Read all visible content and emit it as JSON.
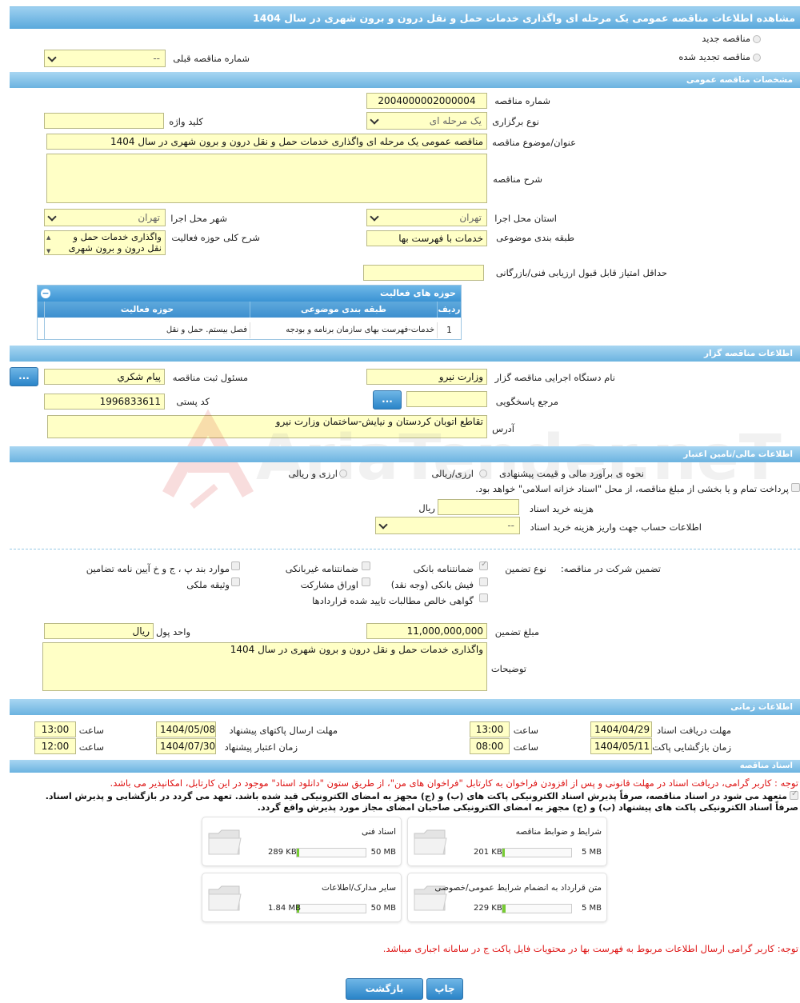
{
  "title": "مشاهده اطلاعات مناقصه عمومی یک مرحله ای واگذاری خدمات حمل و نقل درون و برون شهری در سال 1404",
  "top": {
    "radio_new": "مناقصه جدید",
    "radio_renewed": "مناقصه تجدید شده",
    "prev_tender_label": "شماره مناقصه قبلی",
    "prev_tender_value": "--"
  },
  "general": {
    "header": "مشخصات مناقصه عمومی",
    "tender_number_label": "شماره مناقصه",
    "tender_number": "2004000002000004",
    "holding_type_label": "نوع برگزاری",
    "holding_type": "یک مرحله ای",
    "keyword_label": "کلید واژه",
    "keyword": "",
    "subject_label": "عنوان/موضوع مناقصه",
    "subject": "مناقصه عمومی یک مرحله ای واگذاری خدمات حمل و نقل درون و برون شهری  در سال 1404",
    "description_label": "شرح مناقصه",
    "description": "",
    "province_label": "استان محل اجرا",
    "province": "تهران",
    "city_label": "شهر محل اجرا",
    "city": "تهران",
    "category_label": "طبقه بندی موضوعی",
    "category": "خدمات با فهرست بها",
    "activity_desc_label": "شرح کلی حوزه فعالیت",
    "activity_desc": "واگذاری خدمات حمل و نقل درون و برون شهری  در",
    "min_score_label": "حداقل امتیاز قابل قبول ارزیابی فنی/بازرگانی",
    "min_score": ""
  },
  "activities": {
    "title": "حوزه های فعالیت",
    "columns": [
      "ردیف",
      "طبقه بندی موضوعی",
      "حوزه فعالیت"
    ],
    "rows": [
      [
        "1",
        "خدمات-فهرست بهای سازمان برنامه و بودجه",
        "فصل بیستم. حمل و نقل"
      ]
    ]
  },
  "organizer": {
    "header": "اطلاعات مناقصه گزار",
    "org_name_label": "نام دستگاه اجرایی مناقصه گزار",
    "org_name": "وزارت نیرو",
    "registrar_label": "مسئول ثبت مناقصه",
    "registrar": "پیام شکري",
    "responder_label": "مرجع پاسخگویی",
    "responder": "",
    "postal_label": "کد پستی",
    "postal": "1996833611",
    "address_label": "آدرس",
    "address": "تقاطع اتوبان کردستان و نیایش-ساختمان وزارت نیرو",
    "dots": "..."
  },
  "finance": {
    "header": "اطلاعات مالی/تامین اعتبار",
    "estimate_label": "نحوه ی برآورد مالی و قیمت پیشنهادی",
    "opt_rial": "ارزی/ریالی",
    "opt_fx": "ارزی و ریالی",
    "payment_text": "پرداخت تمام و یا بخشی از مبلغ مناقصه، از محل \"اسناد خزانه اسلامی\" خواهد بود.",
    "doc_fee_label": "هزینه خرید اسناد",
    "doc_fee_unit": "ریال",
    "account_label": "اطلاعات حساب جهت واریز هزینه خرید اسناد",
    "account_value": "--"
  },
  "guarantee": {
    "participation_label": "تضمین شرکت در مناقصه:",
    "type_label": "نوع تضمین",
    "opts": [
      "ضمانتنامه بانکی",
      "ضمانتنامه غیربانکی",
      "موارد بند پ ، ج و خ آیین نامه تضامین",
      "فیش بانکی (وجه نقد)",
      "اوراق مشارکت",
      "وثیقه ملکی",
      "گواهی خالص مطالبات تایید شده قراردادها"
    ],
    "amount_label": "مبلغ تضمین",
    "amount": "11,000,000,000",
    "unit_label": "واحد پول",
    "unit": "ریال",
    "notes_label": "توضیحات",
    "notes": "واگذاری خدمات حمل و نقل درون و برون شهری  در سال 1404"
  },
  "timing": {
    "header": "اطلاعات زمانی",
    "receive_deadline_label": "مهلت دریافت اسناد",
    "receive_date": "1404/04/29",
    "receive_time": "13:00",
    "send_deadline_label": "مهلت ارسال پاکتهای پیشنهاد",
    "send_date": "1404/05/08",
    "send_time": "13:00",
    "open_label": "زمان بازگشایی پاکت ها",
    "open_date": "1404/05/11",
    "open_time": "08:00",
    "validity_label": "زمان اعتبار پیشنهاد",
    "validity_date": "1404/07/30",
    "validity_time": "12:00",
    "time_label": "ساعت"
  },
  "docs": {
    "header": "اسناد مناقصه",
    "note1": "توجه : کاربر گرامی، دریافت اسناد در مهلت قانونی و پس از افزودن فراخوان به کارتابل \"فراخوان های من\"، از طریق ستون \"دانلود اسناد\" موجود در این کارتابل، امکانپذیر می باشد.",
    "commit1": "متعهد می شود در اسناد مناقصه، صرفاً پذیرش اسناد الکترونیکی پاکت های (ب) و (ج) مجهز به امضای الکترونیکی قید شده باشد. تعهد می گردد در بازگشایی و پذیرش اسناد.",
    "commit2": "صرفاً اسناد الکترونیکی پاکت های پیشنهاد (ب) و (ج) مجهز به امضای الکترونیکی صاحبان امضای مجاز مورد پذیرش واقع گردد.",
    "files": [
      {
        "name": "شرایط و ضوابط مناقصه",
        "size": "201 KB",
        "max": "5 MB",
        "fill": 0.04
      },
      {
        "name": "اسناد فنی",
        "size": "289 KB",
        "max": "50 MB",
        "fill": 0.006
      },
      {
        "name": "متن قرارداد به انضمام شرایط عمومی/خصوصی",
        "size": "229 KB",
        "max": "5 MB",
        "fill": 0.045
      },
      {
        "name": "سایر مدارک/اطلاعات",
        "size": "1.84 MB",
        "max": "50 MB",
        "fill": 0.037
      }
    ],
    "note2": "توجه: کاربر گرامی ارسال اطلاعات مربوط به فهرست بها در محتویات فایل پاکت ج در سامانه اجباری میباشد."
  },
  "buttons": {
    "print": "چاپ",
    "back": "بازگشت"
  },
  "watermark": "AriaTender.neT",
  "colors": {
    "header": "#5aa9dc",
    "input_bg": "#ffffc6",
    "notice": "#d11111"
  }
}
